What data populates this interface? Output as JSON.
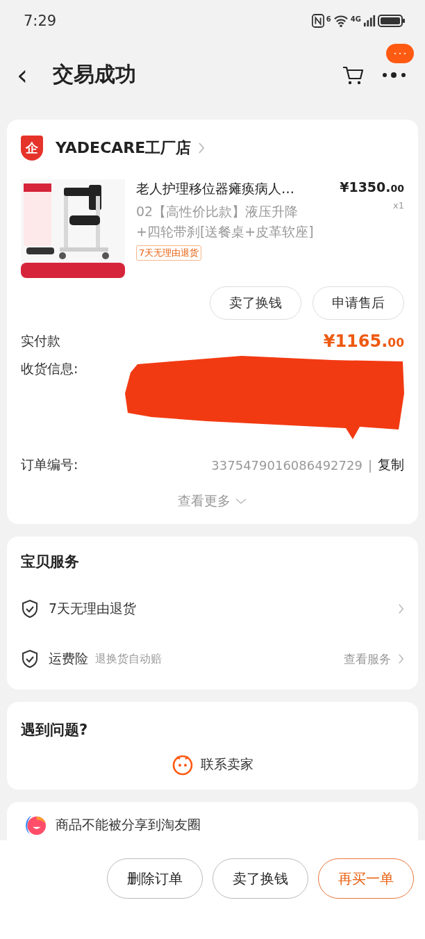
{
  "status_bar": {
    "time": "7:29",
    "wifi_badge": "6",
    "network": "4G"
  },
  "header": {
    "back": "‹",
    "title": "交易成功",
    "notification": true
  },
  "order": {
    "shop": {
      "logo_text": "企",
      "name": "YADECARE工厂店"
    },
    "product": {
      "kind": "picture",
      "title": "老人护理移位器瘫痪病人…",
      "variant": "02【高性价比款】液压升降+四轮带刹[送餐桌+皮革软座]",
      "price_main": "¥1350.",
      "price_cents": "00",
      "quantity": "x1",
      "tag": "7天无理由退货"
    },
    "item_buttons": [
      "卖了换钱",
      "申请售后"
    ],
    "paid": {
      "label": "实付款",
      "amount_main": "¥1165.",
      "amount_cents": "00"
    },
    "shipping": {
      "label": "收货信息:",
      "redacted": true
    },
    "order_no": {
      "label": "订单编号:",
      "value": "3375479016086492729",
      "separator": "|",
      "copy": "复制"
    },
    "more": "查看更多"
  },
  "services": {
    "title": "宝贝服务",
    "items": [
      {
        "label": "7天无理由退货"
      },
      {
        "label": "运费险",
        "note": "退换货自动赔",
        "link": "查看服务"
      }
    ]
  },
  "help": {
    "title": "遇到问题?",
    "contact": "联系卖家"
  },
  "share_notice": "商品不能被分享到淘友圈",
  "actions": [
    {
      "label": "删除订单",
      "primary": false
    },
    {
      "label": "卖了换钱",
      "primary": false
    },
    {
      "label": "再买一单",
      "primary": true
    }
  ]
}
